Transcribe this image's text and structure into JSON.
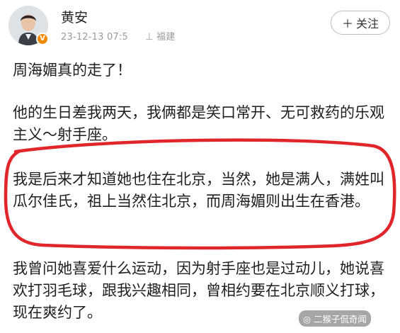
{
  "header": {
    "username": "黄安",
    "timestamp": "23-12-13 07:5",
    "location": "福建",
    "follow_label": "关注",
    "follow_icon": "plus-icon",
    "verified_icon": "verified-badge-icon"
  },
  "post": {
    "paragraphs": [
      "周海媚真的走了！",
      "他的生日差我两天，我俩都是笑口常开、无可救药的乐观主义～射手座。",
      "我是后来才知道她也住在北京，当然，她是满人，满姓叫瓜尔佳氏，祖上当然住北京，而周海媚则出生在香港。",
      "我曾问她喜爱什么运动，因为射手座也是过动儿，她说喜欢打羽毛球，跟我兴趣相同，曾相约要在北京顺义打球，现在爽约了。"
    ]
  },
  "watermark": "二猴子侃奇闻",
  "colors": {
    "highlight": "#e0262b",
    "verified_badge": "#f28a00",
    "meta_text": "#9a9a9a"
  }
}
